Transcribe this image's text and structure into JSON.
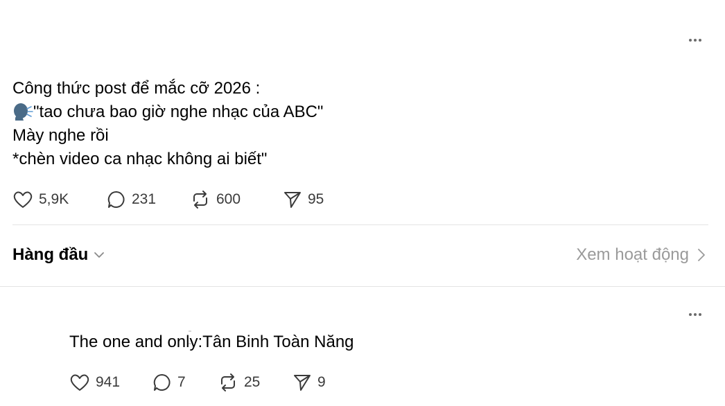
{
  "post": {
    "lines": [
      "Công thức post để mắc cỡ 2026 :",
      "\"tao chưa bao giờ nghe nhạc của ABC\"",
      "Mày nghe rồi",
      "*chèn video ca nhạc không ai biết\""
    ],
    "emoji_icon": "speaking-head-icon",
    "stats": {
      "likes": "5,9K",
      "comments": "231",
      "reposts": "600",
      "shares": "95"
    }
  },
  "replies_header": {
    "sort_label": "Hàng đầu",
    "activity_label": "Xem hoạt động"
  },
  "reply": {
    "text": "The one and only:Tân Binh Toàn Năng",
    "stats": {
      "likes": "941",
      "comments": "7",
      "reposts": "25",
      "shares": "9"
    }
  },
  "colors": {
    "text": "#000000",
    "muted": "#9a9a9a",
    "icon": "#3a3a3a",
    "divider": "#e3e3e3"
  }
}
